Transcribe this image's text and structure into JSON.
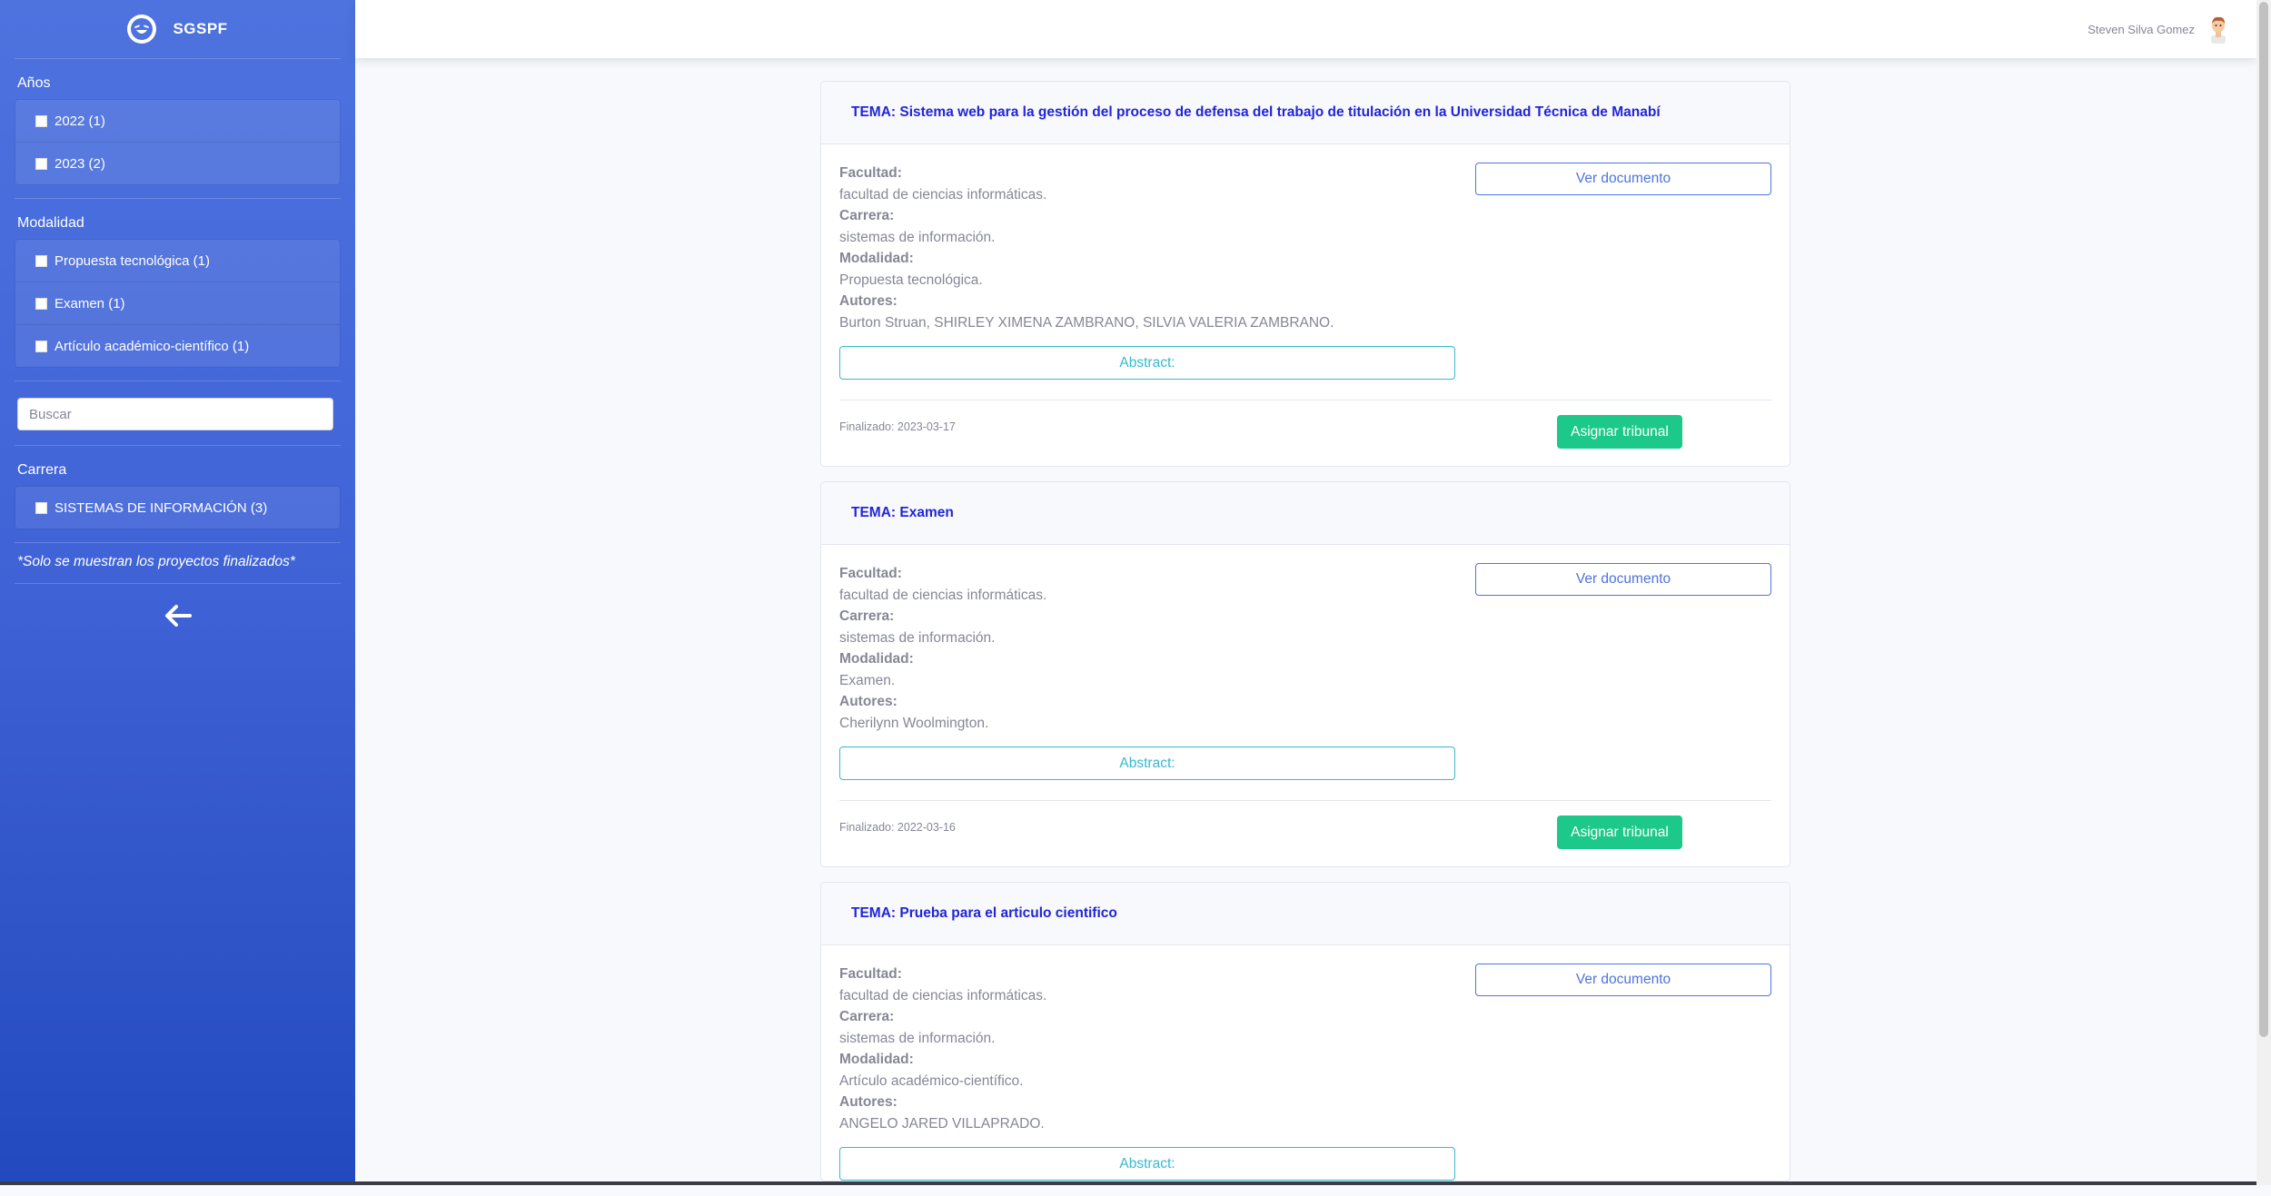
{
  "brand": {
    "name": "SGSPF",
    "logo_icon": "laughing-face-icon"
  },
  "sidebar": {
    "years_title": "Años",
    "years": [
      "2022 (1)",
      "2023 (2)"
    ],
    "modality_title": "Modalidad",
    "modalities": [
      "Propuesta tecnológica (1)",
      "Examen (1)",
      "Artículo académico-científico (1)"
    ],
    "search_placeholder": "Buscar",
    "career_title": "Carrera",
    "careers": [
      "SISTEMAS DE INFORMACIÓN (3)"
    ],
    "note": "*Solo se muestran los proyectos finalizados*"
  },
  "topbar": {
    "user_name": "Steven Silva Gomez"
  },
  "labels": {
    "facultad": "Facultad:",
    "carrera": "Carrera:",
    "modalidad": "Modalidad:",
    "autores": "Autores:",
    "ver_documento": "Ver documento",
    "abstract": "Abstract:",
    "asignar": "Asignar tribunal"
  },
  "projects": [
    {
      "title": "TEMA: Sistema web para la gestión del proceso de defensa del trabajo de titulación en la Universidad Técnica de Manabí",
      "facultad": "facultad de ciencias informáticas.",
      "carrera": "sistemas de información.",
      "modalidad": "Propuesta tecnológica.",
      "autores": "Burton Struan, SHIRLEY XIMENA ZAMBRANO, SILVIA VALERIA ZAMBRANO.",
      "finalizado": "Finalizado: 2023-03-17"
    },
    {
      "title": "TEMA: Examen",
      "facultad": "facultad de ciencias informáticas.",
      "carrera": "sistemas de información.",
      "modalidad": "Examen.",
      "autores": "Cherilynn Woolmington.",
      "finalizado": "Finalizado: 2022-03-16"
    },
    {
      "title": "TEMA: Prueba para el articulo cientifico",
      "facultad": "facultad de ciencias informáticas.",
      "carrera": "sistemas de información.",
      "modalidad": "Artículo académico-científico.",
      "autores": "ANGELO JARED VILLAPRADO."
    }
  ],
  "colors": {
    "sidebar_gradient_top": "#4e73df",
    "sidebar_gradient_bottom": "#224abe",
    "title_blue": "#2125d8",
    "success_green": "#1cc88a",
    "info_cyan": "#36b9cc"
  }
}
